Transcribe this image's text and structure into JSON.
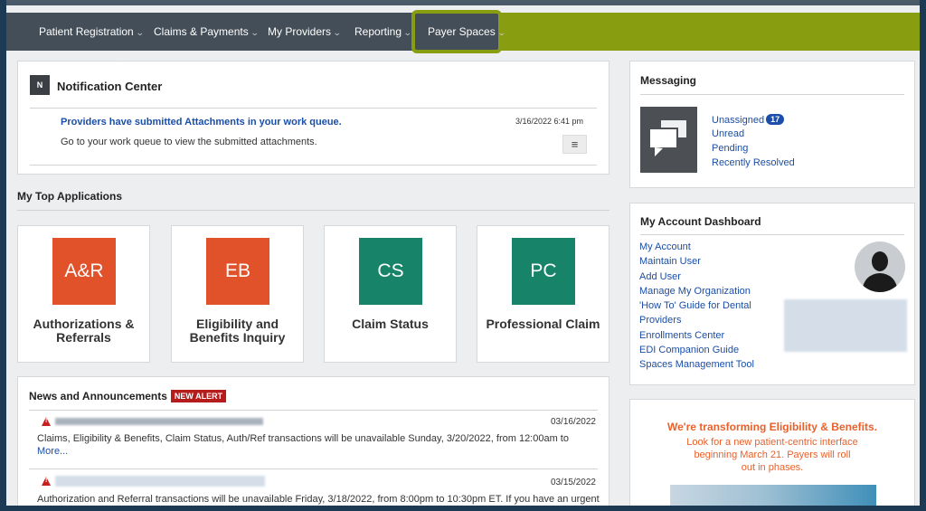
{
  "nav": {
    "items": [
      {
        "label": "Patient Registration"
      },
      {
        "label": "Claims & Payments"
      },
      {
        "label": "My Providers"
      },
      {
        "label": "Reporting"
      },
      {
        "label": "Payer Spaces"
      }
    ],
    "chevron": "⌄"
  },
  "notification": {
    "badge": "N",
    "title": "Notification Center",
    "headline": "Providers have submitted Attachments in your work queue.",
    "body": "Go to your work queue to view the submitted attachments.",
    "timestamp": "3/16/2022 6:41 pm",
    "menu_icon": "≡"
  },
  "top_apps": {
    "heading": "My Top Applications",
    "tiles": [
      {
        "code": "A&R",
        "name": "Authorizations & Referrals",
        "color": "#e2522a"
      },
      {
        "code": "EB",
        "name": "Eligibility and Benefits Inquiry",
        "color": "#e2522a"
      },
      {
        "code": "CS",
        "name": "Claim Status",
        "color": "#17846a"
      },
      {
        "code": "PC",
        "name": "Professional Claim",
        "color": "#17846a"
      }
    ]
  },
  "news": {
    "title": "News and Announcements",
    "alert_badge": "NEW ALERT",
    "items": [
      {
        "date": "03/16/2022",
        "body": "Claims, Eligibility & Benefits, Claim Status, Auth/Ref transactions will be unavailable Sunday, 3/20/2022, from 12:00am to",
        "more": "More..."
      },
      {
        "date": "03/15/2022",
        "body": "Authorization and Referral transactions will be unavailable Friday, 3/18/2022, from 8:00pm to 10:30pm ET. If you have an urgent"
      }
    ]
  },
  "messaging": {
    "title": "Messaging",
    "items": [
      {
        "label": "Unassigned",
        "count": "17"
      },
      {
        "label": "Unread"
      },
      {
        "label": "Pending"
      },
      {
        "label": "Recently Resolved"
      }
    ]
  },
  "account": {
    "title": "My Account Dashboard",
    "links": [
      "My Account",
      "Maintain User",
      "Add User",
      "Manage My Organization",
      "'How To' Guide for Dental",
      "Providers",
      "Enrollments Center",
      "EDI Companion Guide",
      "Spaces Management Tool"
    ]
  },
  "promo": {
    "headline": "We're transforming Eligibility & Benefits.",
    "body_lines": [
      "Look for a new patient-centric interface",
      "beginning March 21. Payers will roll",
      "out in phases."
    ],
    "headline_color": "#e8612c"
  },
  "colors": {
    "nav_bg": "#444e58",
    "nav_accent": "#899d10",
    "link": "#1a4ea8",
    "alert": "#b51c1c"
  }
}
